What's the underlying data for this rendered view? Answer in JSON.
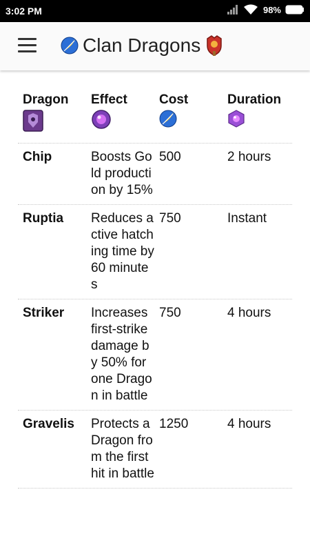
{
  "status_bar": {
    "time": "3:02 PM",
    "battery": "98%"
  },
  "app_bar": {
    "title": "Clan Dragons"
  },
  "table": {
    "headers": [
      "Dragon",
      "Effect",
      "Cost",
      "Duration"
    ],
    "rows": [
      {
        "dragon": "Chip",
        "effect": "Boosts Gold production by 15%",
        "cost": "500",
        "duration": "2 hours"
      },
      {
        "dragon": "Ruptia",
        "effect": "Reduces active hatching time by 60 minutes",
        "cost": "750",
        "duration": "Instant"
      },
      {
        "dragon": "Striker",
        "effect": "Increases first-strike damage by 50% for one Dragon in battle",
        "cost": "750",
        "duration": "4 hours"
      },
      {
        "dragon": "Gravelis",
        "effect": "Protects a Dragon from the first hit in battle",
        "cost": "1250",
        "duration": "4 hours"
      }
    ]
  },
  "icons": {
    "title_left": "blue-feather-orb-icon",
    "title_right": "clan-shield-icon",
    "dragon_header": "dragon-card-icon",
    "effect_header": "purple-orb-icon",
    "cost_header": "blue-feather-orb-icon",
    "duration_header": "purple-gem-icon"
  }
}
